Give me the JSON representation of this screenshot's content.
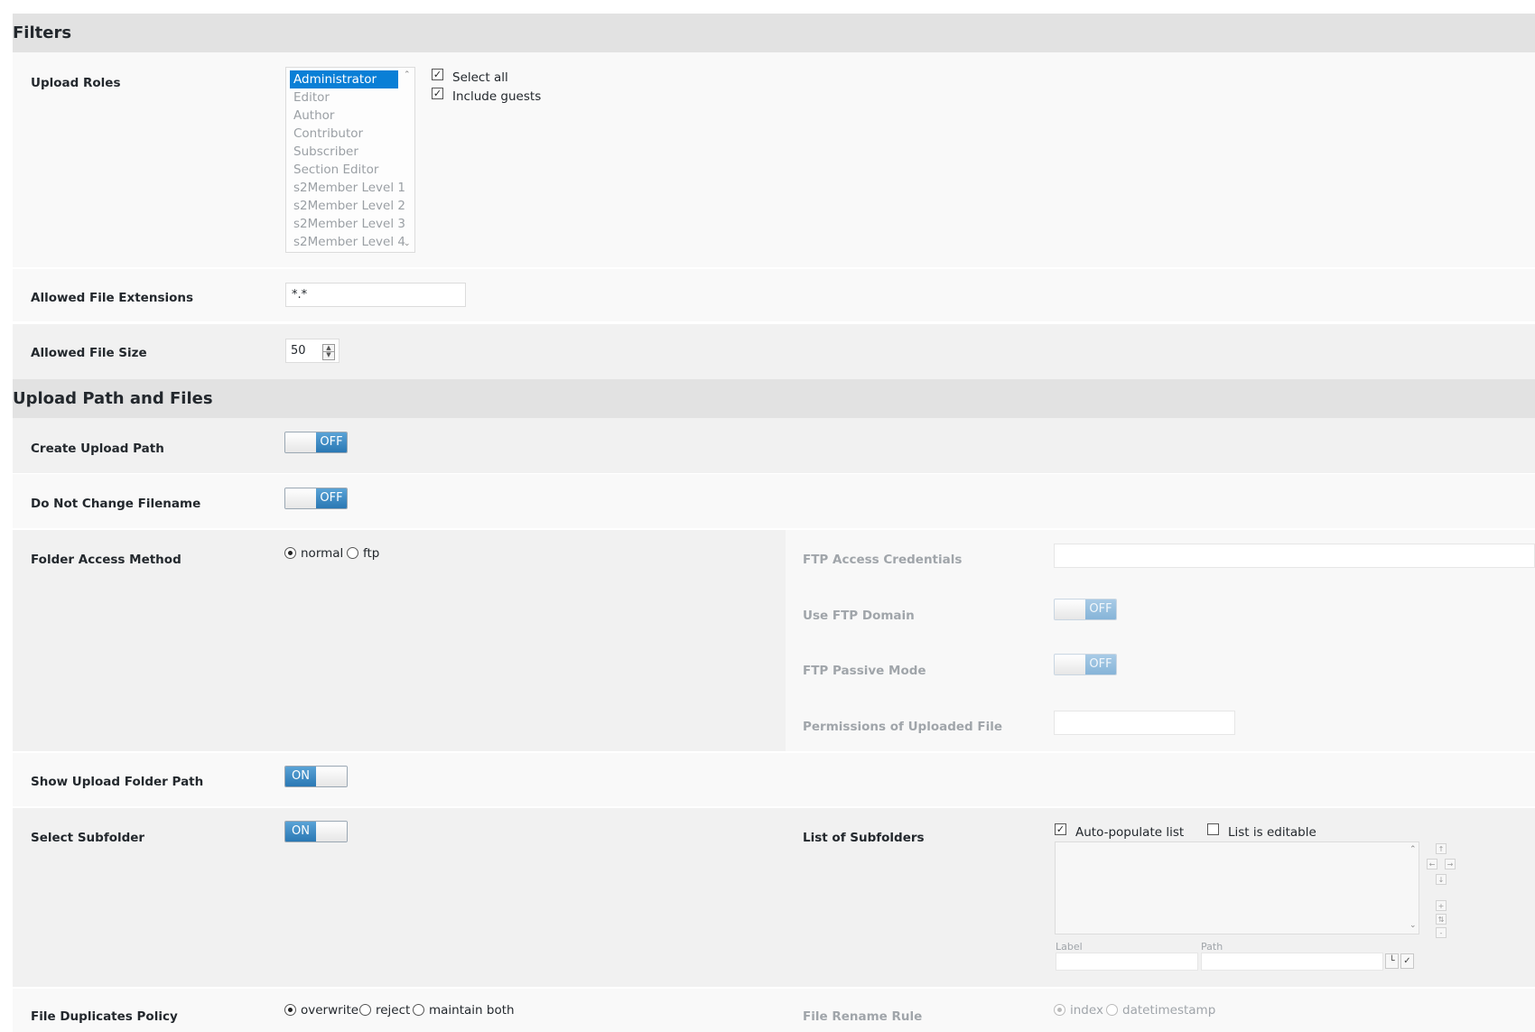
{
  "filters": {
    "title": "Filters",
    "upload_roles": {
      "label": "Upload Roles",
      "options": [
        "Administrator",
        "Editor",
        "Author",
        "Contributor",
        "Subscriber",
        "Section Editor",
        "s2Member Level 1",
        "s2Member Level 2",
        "s2Member Level 3",
        "s2Member Level 4"
      ],
      "select_all_label": "Select all",
      "include_guests_label": "Include guests"
    },
    "allowed_ext": {
      "label": "Allowed File Extensions",
      "value": "*.*"
    },
    "allowed_size": {
      "label": "Allowed File Size",
      "value": "50"
    }
  },
  "upload": {
    "title": "Upload Path and Files",
    "create_path": {
      "label": "Create Upload Path",
      "state": "OFF"
    },
    "no_change_filename": {
      "label": "Do Not Change Filename",
      "state": "OFF"
    },
    "folder_access": {
      "label": "Folder Access Method",
      "options": [
        "normal",
        "ftp"
      ],
      "ftp_credentials_label": "FTP Access Credentials",
      "use_ftp_domain": {
        "label": "Use FTP Domain",
        "state": "OFF"
      },
      "ftp_passive": {
        "label": "FTP Passive Mode",
        "state": "OFF"
      },
      "permissions_label": "Permissions of Uploaded File"
    },
    "show_folder_path": {
      "label": "Show Upload Folder Path",
      "state": "ON"
    },
    "select_subfolder": {
      "label": "Select Subfolder",
      "state": "ON",
      "list_label": "List of Subfolders",
      "auto_populate_label": "Auto-populate list",
      "editable_label": "List is editable",
      "label_field": "Label",
      "path_field": "Path"
    },
    "duplicates": {
      "label": "File Duplicates Policy",
      "options": [
        "overwrite",
        "reject",
        "maintain both"
      ],
      "rename_label": "File Rename Rule",
      "rename_options": [
        "index",
        "datetimestamp"
      ]
    }
  }
}
